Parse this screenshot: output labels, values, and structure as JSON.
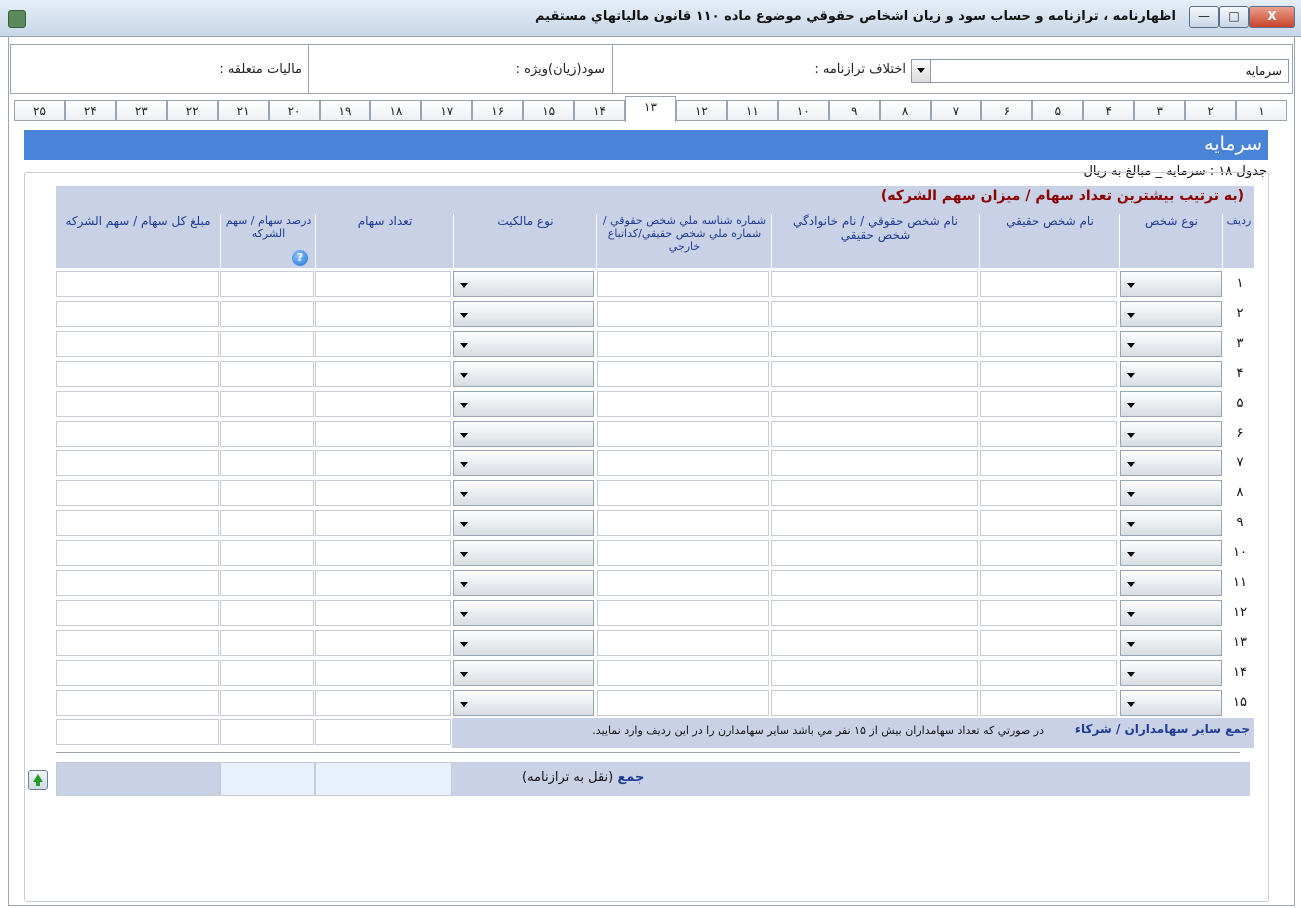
{
  "window": {
    "title": "اظهارنامه ، ترازنامه و حساب سود و زیان اشخاص حقوقي موضوع ماده ١١٠ قانون مالياتهاي مستقيم",
    "min_label": "—",
    "max_label": "□",
    "close_label": "X"
  },
  "summary": {
    "tax_label": "ماليات متعلقه :",
    "profit_label": "سود(زيان)ويژه :",
    "balance_label": "اختلاف ترازنامه :",
    "section_combo_value": "سرمايه"
  },
  "tabs": [
    "١",
    "٢",
    "٣",
    "۴",
    "۵",
    "۶",
    "٧",
    "٨",
    "٩",
    "١٠",
    "١١",
    "١٢",
    "١٣",
    "١۴",
    "١۵",
    "١۶",
    "١٧",
    "١٨",
    "١٩",
    "٢٠",
    "٢١",
    "٢٢",
    "٢٣",
    "٢۴",
    "٢۵"
  ],
  "active_tab": "١٣",
  "section": {
    "title": "سرمايه",
    "caption": "جدول ١٨ : سرمايه _ مبالغ به ريال",
    "table_title": "(به ترتيب بيشترين تعداد سهام / ميزان سهم الشركه)"
  },
  "columns": {
    "row_no": "رديف",
    "person_type": "نوع شخص",
    "real_name": "نام شخص حقيقي",
    "legal_name": "نام شخص حقوقي / نام خانوادگي شخص حقيقي",
    "national_id": "شماره شناسه ملي شخص حقوقي / شماره ملي شخص حقيقي/كداتباع خارجي",
    "ownership_type": "نوع مالكيت",
    "share_count": "تعداد سهام",
    "share_percent": "درصد سهام / سهم الشركه",
    "total_amount": "مبلغ كل سهام / سهم الشركه"
  },
  "rows": [
    "١",
    "٢",
    "٣",
    "۴",
    "۵",
    "۶",
    "٧",
    "٨",
    "٩",
    "١٠",
    "١١",
    "١٢",
    "١٣",
    "١۴",
    "١۵"
  ],
  "others": {
    "label": "جمع ساير سهامداران / شركاء",
    "note": "در صورتي كه تعداد سهامداران بيش از ١۵ نفر مي باشد ساير سهامدارن را در اين رديف وارد نماييد."
  },
  "total": {
    "label": "جمع",
    "sub": "(نقل به ترازنامه)"
  },
  "help_icon": "?"
}
